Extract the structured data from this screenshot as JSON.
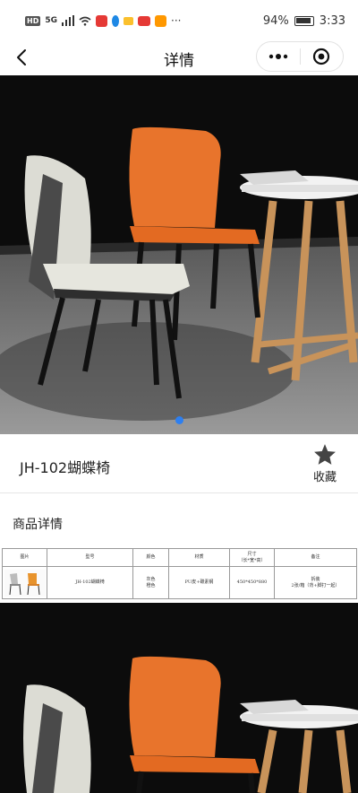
{
  "status_bar": {
    "network": "HD",
    "signal_tag": "5G",
    "battery_percent": "94%",
    "time": "3:33",
    "more": "···"
  },
  "nav": {
    "title": "详情"
  },
  "hero": {
    "active_slide_color": "#2d7ff0"
  },
  "product": {
    "title": "JH-102蝴蝶椅",
    "favorite_label": "收藏"
  },
  "details": {
    "section_title": "商品详情",
    "table": {
      "headers": [
        "图片",
        "型号",
        "颜色",
        "材质",
        "尺寸\n（长*宽*高）",
        "备注"
      ],
      "row": {
        "model": "JH-102蝴蝶椅",
        "colors": "灰色\n橙色",
        "material": "PU皮+碳素钢",
        "size": "450*450*880",
        "note": "拆装\n2张/箱（背+脚打一起）"
      }
    }
  },
  "colors": {
    "accent_blue": "#2d7ff0",
    "chair_orange": "#e8742c",
    "chair_white": "#dcdcd4"
  }
}
